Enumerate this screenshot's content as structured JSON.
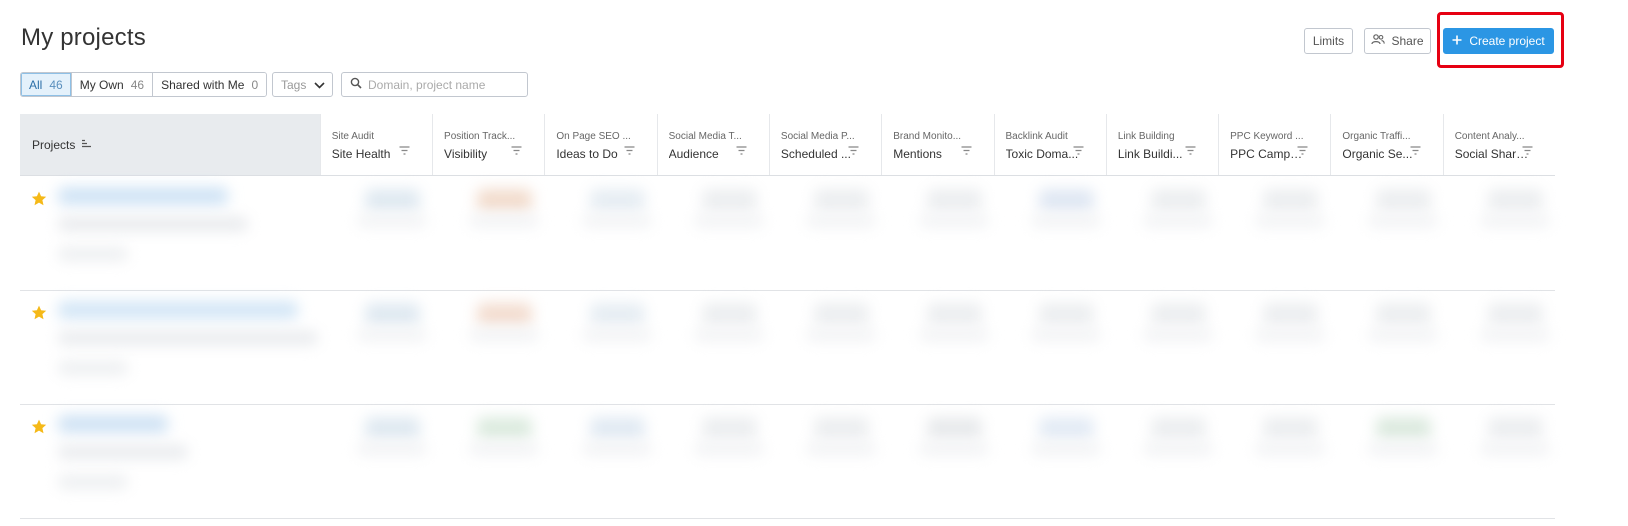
{
  "page": {
    "title": "My projects"
  },
  "header_buttons": {
    "limits_label": "Limits",
    "share_label": "Share",
    "create_label": "Create project"
  },
  "filters": {
    "tabs": [
      {
        "label": "All",
        "count": "46",
        "active": true
      },
      {
        "label": "My Own",
        "count": "46",
        "active": false
      },
      {
        "label": "Shared with Me",
        "count": "0",
        "active": false
      }
    ],
    "tags_label": "Tags",
    "search_placeholder": "Domain, project name"
  },
  "table": {
    "projects_header": "Projects",
    "columns": [
      {
        "tool": "Site Audit",
        "metric": "Site Health"
      },
      {
        "tool": "Position Track...",
        "metric": "Visibility"
      },
      {
        "tool": "On Page SEO ...",
        "metric": "Ideas to Do"
      },
      {
        "tool": "Social Media T...",
        "metric": "Audience"
      },
      {
        "tool": "Social Media P...",
        "metric": "Scheduled ..."
      },
      {
        "tool": "Brand Monito...",
        "metric": "Mentions"
      },
      {
        "tool": "Backlink Audit",
        "metric": "Toxic Doma..."
      },
      {
        "tool": "Link Building",
        "metric": "Link Buildi..."
      },
      {
        "tool": "PPC Keyword ...",
        "metric": "PPC Campa..."
      },
      {
        "tool": "Organic Traffi...",
        "metric": "Organic Se..."
      },
      {
        "tool": "Content Analy...",
        "metric": "Social Shares"
      }
    ],
    "rows": [
      {
        "starred": true
      },
      {
        "starred": true
      },
      {
        "starred": true
      }
    ]
  },
  "colors": {
    "accent": "#2b96e4",
    "highlight": "#e60012",
    "star": "#f5b918",
    "header_bg": "#e8ebee"
  }
}
